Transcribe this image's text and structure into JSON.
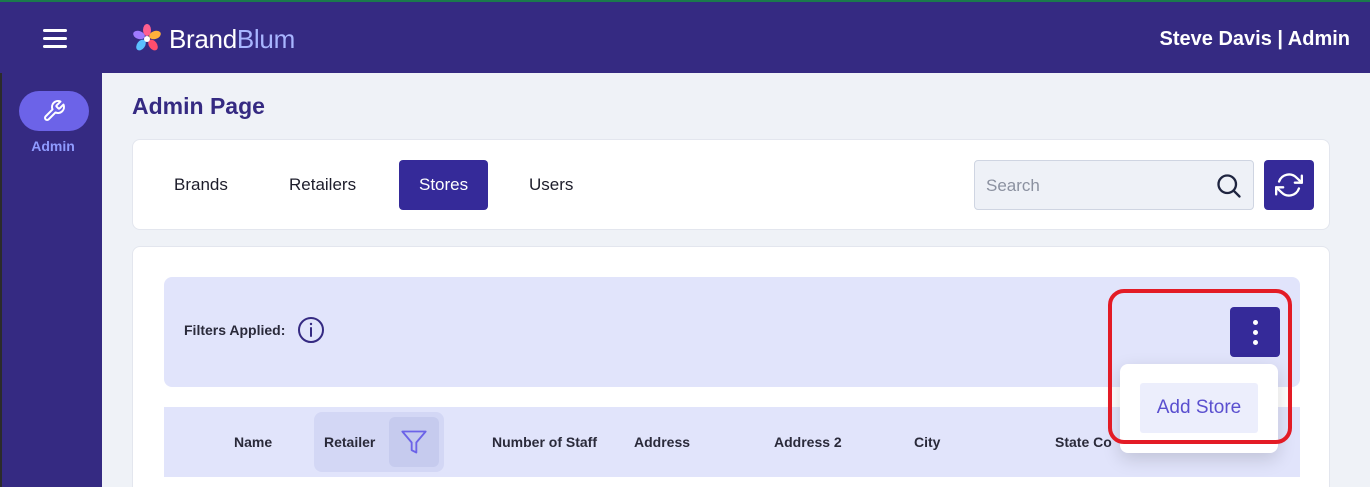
{
  "header": {
    "logo_brand": "Brand",
    "logo_blum": "Blum",
    "user_label": "Steve Davis | Admin"
  },
  "sidebar": {
    "items": [
      {
        "label": "Admin",
        "icon": "wrench-icon",
        "active": true
      }
    ]
  },
  "page": {
    "title": "Admin Page"
  },
  "tabs": [
    {
      "label": "Brands",
      "active": false
    },
    {
      "label": "Retailers",
      "active": false
    },
    {
      "label": "Stores",
      "active": true
    },
    {
      "label": "Users",
      "active": false
    }
  ],
  "search": {
    "placeholder": "Search",
    "value": ""
  },
  "filters": {
    "label": "Filters Applied:"
  },
  "table": {
    "columns": [
      "Name",
      "Retailer",
      "Number of Staff",
      "Address",
      "Address 2",
      "City",
      "State Co"
    ]
  },
  "menu": {
    "items": [
      "Add Store"
    ]
  },
  "colors": {
    "primary": "#352a82",
    "button": "#352a99",
    "accent_light": "#e1e4fb",
    "highlight": "#e31b25"
  }
}
